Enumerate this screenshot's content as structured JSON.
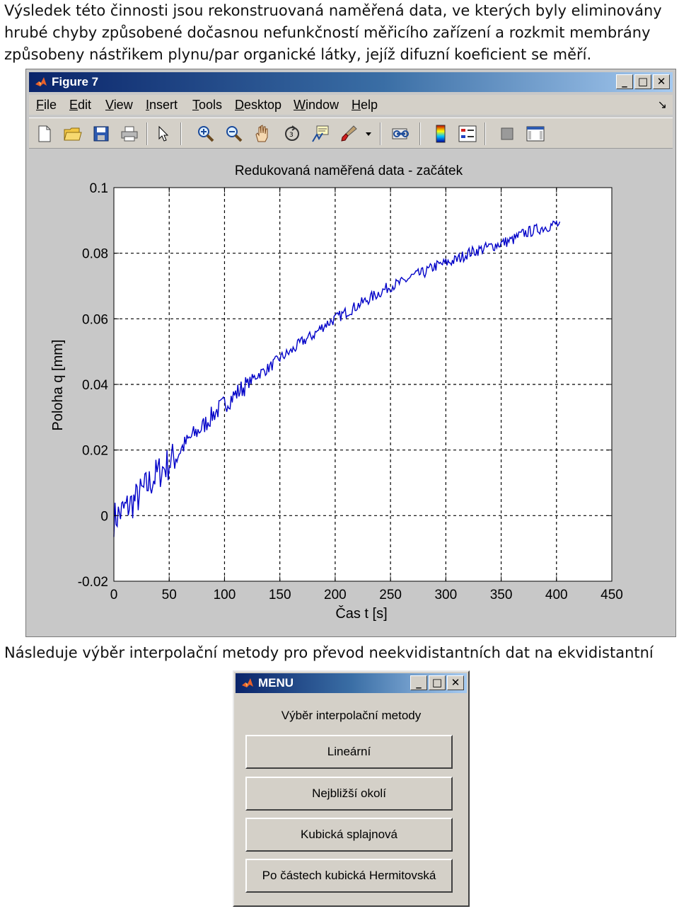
{
  "text": {
    "intro": "Výsledek této činnosti jsou rekonstruovaná naměřená data, ve kterých byly eliminovány hrubé chyby způsobené dočasnou nefunkčností měřicího zařízení a rozkmit membrány způsobeny nástřikem plynu/par organické látky, jejíž difuzní koeficient se měří.",
    "outro": "Následuje výběr interpolační metody pro převod neekvidistantních dat na ekvidistantní"
  },
  "figure_window": {
    "title": "Figure 7",
    "menu": [
      {
        "u": "F",
        "rest": "ile"
      },
      {
        "u": "E",
        "rest": "dit"
      },
      {
        "u": "V",
        "rest": "iew"
      },
      {
        "u": "I",
        "rest": "nsert"
      },
      {
        "u": "T",
        "rest": "ools"
      },
      {
        "u": "D",
        "rest": "esktop"
      },
      {
        "u": "W",
        "rest": "indow"
      },
      {
        "u": "H",
        "rest": "elp"
      }
    ],
    "toolbar_icons": [
      "new-file-icon",
      "open-folder-icon",
      "save-icon",
      "print-icon",
      "pointer-icon",
      "zoom-in-icon",
      "zoom-out-icon",
      "pan-hand-icon",
      "rotate-3d-icon",
      "data-cursor-icon",
      "brush-icon",
      "link-plot-icon",
      "colorbar-icon",
      "legend-icon",
      "hide-plot-tools-icon",
      "show-plot-tools-icon"
    ],
    "window_buttons": [
      "_",
      "□",
      "✕"
    ]
  },
  "chart_data": {
    "type": "line",
    "title": "Redukovaná naměřená  data - začátek",
    "xlabel": "Čas t [s]",
    "ylabel": "Poloha q [mm]",
    "xlim": [
      0,
      450
    ],
    "ylim": [
      -0.02,
      0.1
    ],
    "xticks": [
      0,
      50,
      100,
      150,
      200,
      250,
      300,
      350,
      400,
      450
    ],
    "yticks": [
      -0.02,
      0,
      0.02,
      0.04,
      0.06,
      0.08,
      0.1
    ],
    "xtick_labels": [
      "0",
      "50",
      "100",
      "150",
      "200",
      "250",
      "300",
      "350",
      "400",
      "450"
    ],
    "ytick_labels": [
      "-0.02",
      "0",
      "0.02",
      "0.04",
      "0.06",
      "0.08",
      "0.1"
    ],
    "grid": true,
    "color": "#0000c8",
    "series": [
      {
        "x": [
          0,
          10,
          20,
          30,
          40,
          50,
          60,
          70,
          80,
          90,
          100,
          110,
          120,
          130,
          140,
          150,
          160,
          170,
          180,
          190,
          200,
          210,
          220,
          230,
          240,
          250,
          260,
          270,
          280,
          290,
          300,
          310,
          320,
          330,
          340,
          350,
          360,
          370,
          380,
          390,
          400,
          403
        ],
        "values": [
          -0.001,
          0.002,
          0.005,
          0.009,
          0.013,
          0.016,
          0.02,
          0.024,
          0.027,
          0.031,
          0.034,
          0.037,
          0.04,
          0.043,
          0.045,
          0.048,
          0.05,
          0.053,
          0.055,
          0.058,
          0.06,
          0.062,
          0.064,
          0.066,
          0.068,
          0.07,
          0.071,
          0.073,
          0.074,
          0.076,
          0.077,
          0.078,
          0.08,
          0.081,
          0.082,
          0.083,
          0.084,
          0.086,
          0.087,
          0.088,
          0.089,
          0.088
        ]
      }
    ]
  },
  "menu_dialog": {
    "title": "MENU",
    "label": "Výběr interpolační metody",
    "buttons": [
      "Lineární",
      "Nejbližší okolí",
      "Kubická splajnová",
      "Po částech kubická Hermitovská"
    ],
    "window_buttons": [
      "_",
      "□",
      "✕"
    ]
  }
}
